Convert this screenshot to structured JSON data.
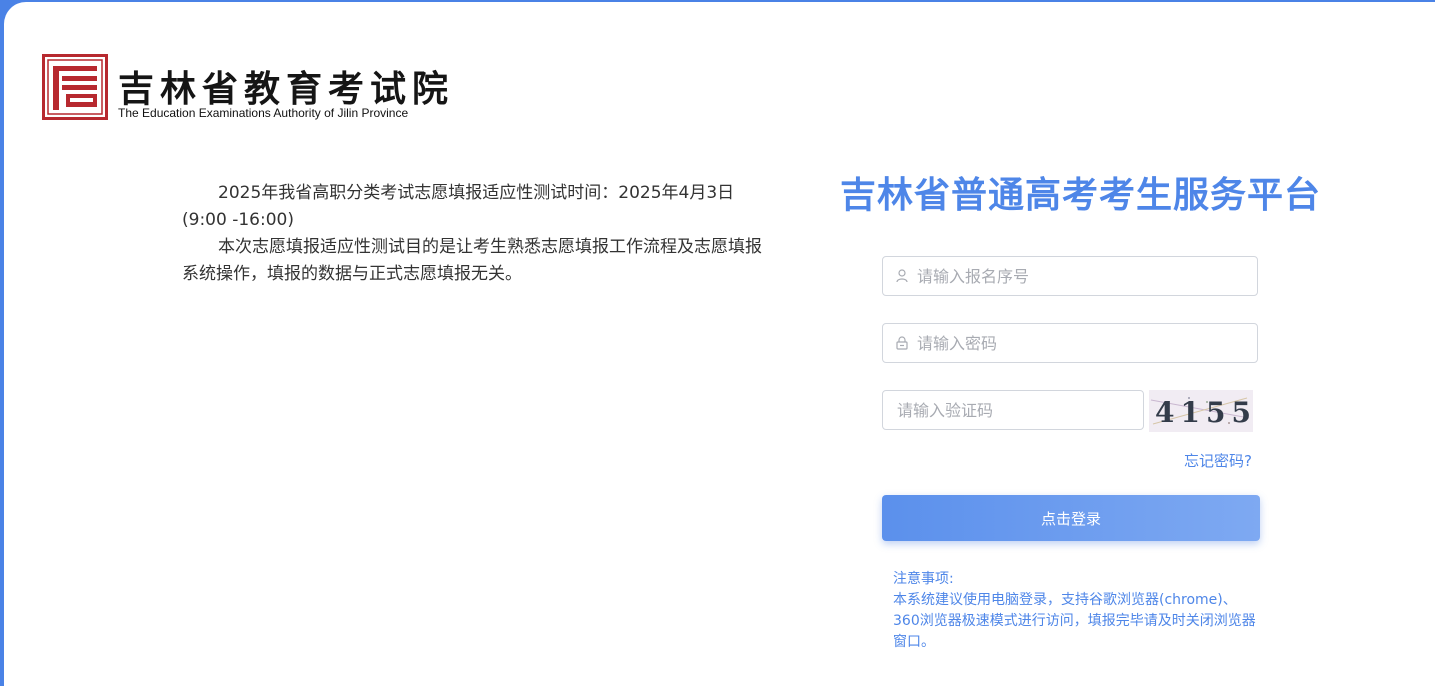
{
  "header": {
    "org_name": "吉林省教育考试院",
    "org_name_en": "The Education Examinations Authority of Jilin Province"
  },
  "notice": {
    "line1": "2025年我省高职分类考试志愿填报适应性测试时间：2025年4月3日(9:00 -16:00)",
    "line2": "本次志愿填报适应性测试目的是让考生熟悉志愿填报工作流程及志愿填报系统操作，填报的数据与正式志愿填报无关。"
  },
  "login": {
    "title": "吉林省普通高考考生服务平台",
    "username_placeholder": "请输入报名序号",
    "password_placeholder": "请输入密码",
    "captcha_placeholder": "请输入验证码",
    "captcha_text": "4155",
    "forgot_label": "忘记密码?",
    "submit_label": "点击登录"
  },
  "tips": {
    "heading": "注意事项:",
    "body": "本系统建议使用电脑登录，支持谷歌浏览器(chrome)、360浏览器极速模式进行访问，填报完毕请及时关闭浏览器窗口。"
  },
  "colors": {
    "accent": "#4e86e8",
    "logo_red": "#b7292f",
    "frame_blue": "#4a82e6"
  },
  "icons": {
    "username": "user-icon",
    "password": "lock-icon"
  }
}
